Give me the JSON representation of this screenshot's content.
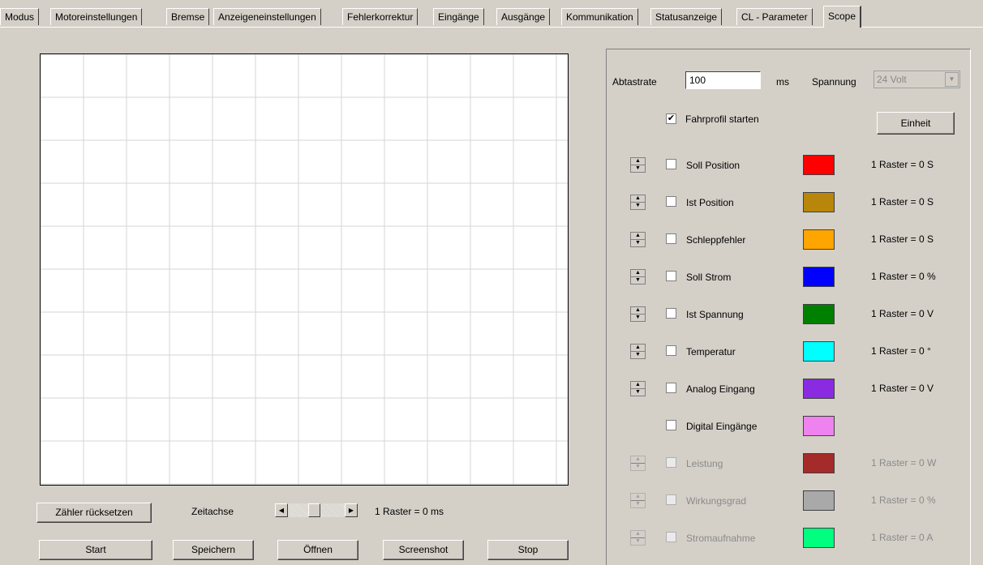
{
  "tabs": [
    "Modus",
    "Motoreinstellungen",
    "Bremse",
    "Anzeigeneinstellungen",
    "Fehlerkorrektur",
    "Eingänge",
    "Ausgänge",
    "Kommunikation",
    "Statusanzeige",
    "CL - Parameter",
    "Scope"
  ],
  "active_tab": "Scope",
  "bottom": {
    "reset_label": "Zähler rücksetzen",
    "zeitachse_label": "Zeitachse",
    "raster_label": "1 Raster = 0 ms",
    "start_label": "Start",
    "save_label": "Speichern",
    "open_label": "Öffnen",
    "screenshot_label": "Screenshot",
    "stop_label": "Stop"
  },
  "settings": {
    "abtastrate_label": "Abtastrate",
    "abtastrate_value": "100",
    "ms_label": "ms",
    "spannung_label": "Spannung",
    "spannung_value": "24 Volt",
    "fahrprofil_label": "Fahrprofil starten",
    "einheit_label": "Einheit"
  },
  "channels": [
    {
      "label": "Soll Position",
      "color": "#ff0000",
      "raster": "1 Raster = 0 S",
      "enabled": true,
      "spinner": true
    },
    {
      "label": "Ist Position",
      "color": "#b8860b",
      "raster": "1 Raster = 0 S",
      "enabled": true,
      "spinner": true
    },
    {
      "label": "Schleppfehler",
      "color": "#ffa500",
      "raster": "1 Raster = 0 S",
      "enabled": true,
      "spinner": true
    },
    {
      "label": "Soll Strom",
      "color": "#0000ff",
      "raster": "1 Raster = 0 %",
      "enabled": true,
      "spinner": true
    },
    {
      "label": "Ist Spannung",
      "color": "#008000",
      "raster": "1 Raster = 0 V",
      "enabled": true,
      "spinner": true
    },
    {
      "label": "Temperatur",
      "color": "#00ffff",
      "raster": "1 Raster = 0 °",
      "enabled": true,
      "spinner": true
    },
    {
      "label": "Analog Eingang",
      "color": "#8a2be2",
      "raster": "1 Raster = 0 V",
      "enabled": true,
      "spinner": true
    },
    {
      "label": "Digital Eingänge",
      "color": "#ee82ee",
      "raster": "",
      "enabled": true,
      "spinner": false
    },
    {
      "label": "Leistung",
      "color": "#a52a2a",
      "raster": "1 Raster = 0 W",
      "enabled": false,
      "spinner": true
    },
    {
      "label": "Wirkungsgrad",
      "color": "#a9a9a9",
      "raster": "1 Raster = 0 %",
      "enabled": false,
      "spinner": true
    },
    {
      "label": "Stromaufnahme",
      "color": "#00ff7f",
      "raster": "1 Raster = 0 A",
      "enabled": false,
      "spinner": true
    }
  ]
}
